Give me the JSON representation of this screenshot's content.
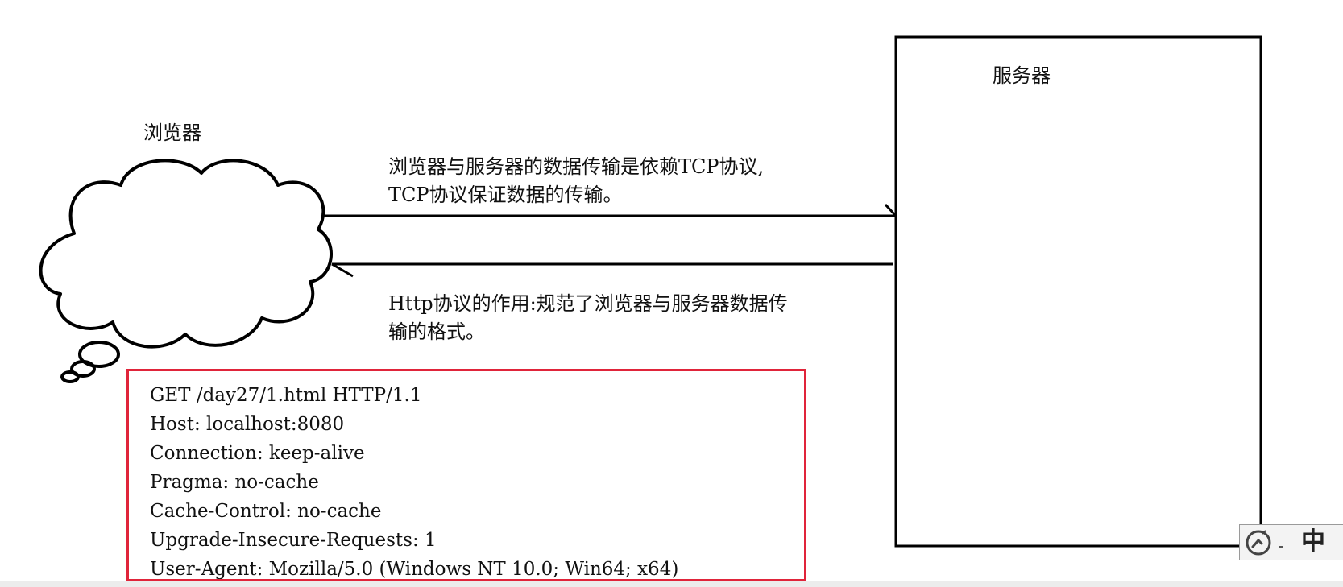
{
  "browser": {
    "label": "浏览器",
    "icon": "cloud-icon"
  },
  "server": {
    "label": "服务器"
  },
  "tcp_note": {
    "line1": "浏览器与服务器的数据传输是依赖TCP协议,",
    "line2": "TCP协议保证数据的传输。"
  },
  "http_note": {
    "line1": "Http协议的作用:规范了浏览器与服务器数据传",
    "line2": "输的格式。"
  },
  "request": {
    "border_color": "#e0243a",
    "lines": [
      "GET /day27/1.html HTTP/1.1",
      "Host: localhost:8080",
      "Connection: keep-alive",
      "Pragma: no-cache",
      "Cache-Control: no-cache",
      "Upgrade-Insecure-Requests: 1",
      "User-Agent: Mozilla/5.0 (Windows NT 10.0; Win64; x64)"
    ]
  },
  "ime": {
    "icon": "input-method-icon",
    "mode": "中"
  }
}
